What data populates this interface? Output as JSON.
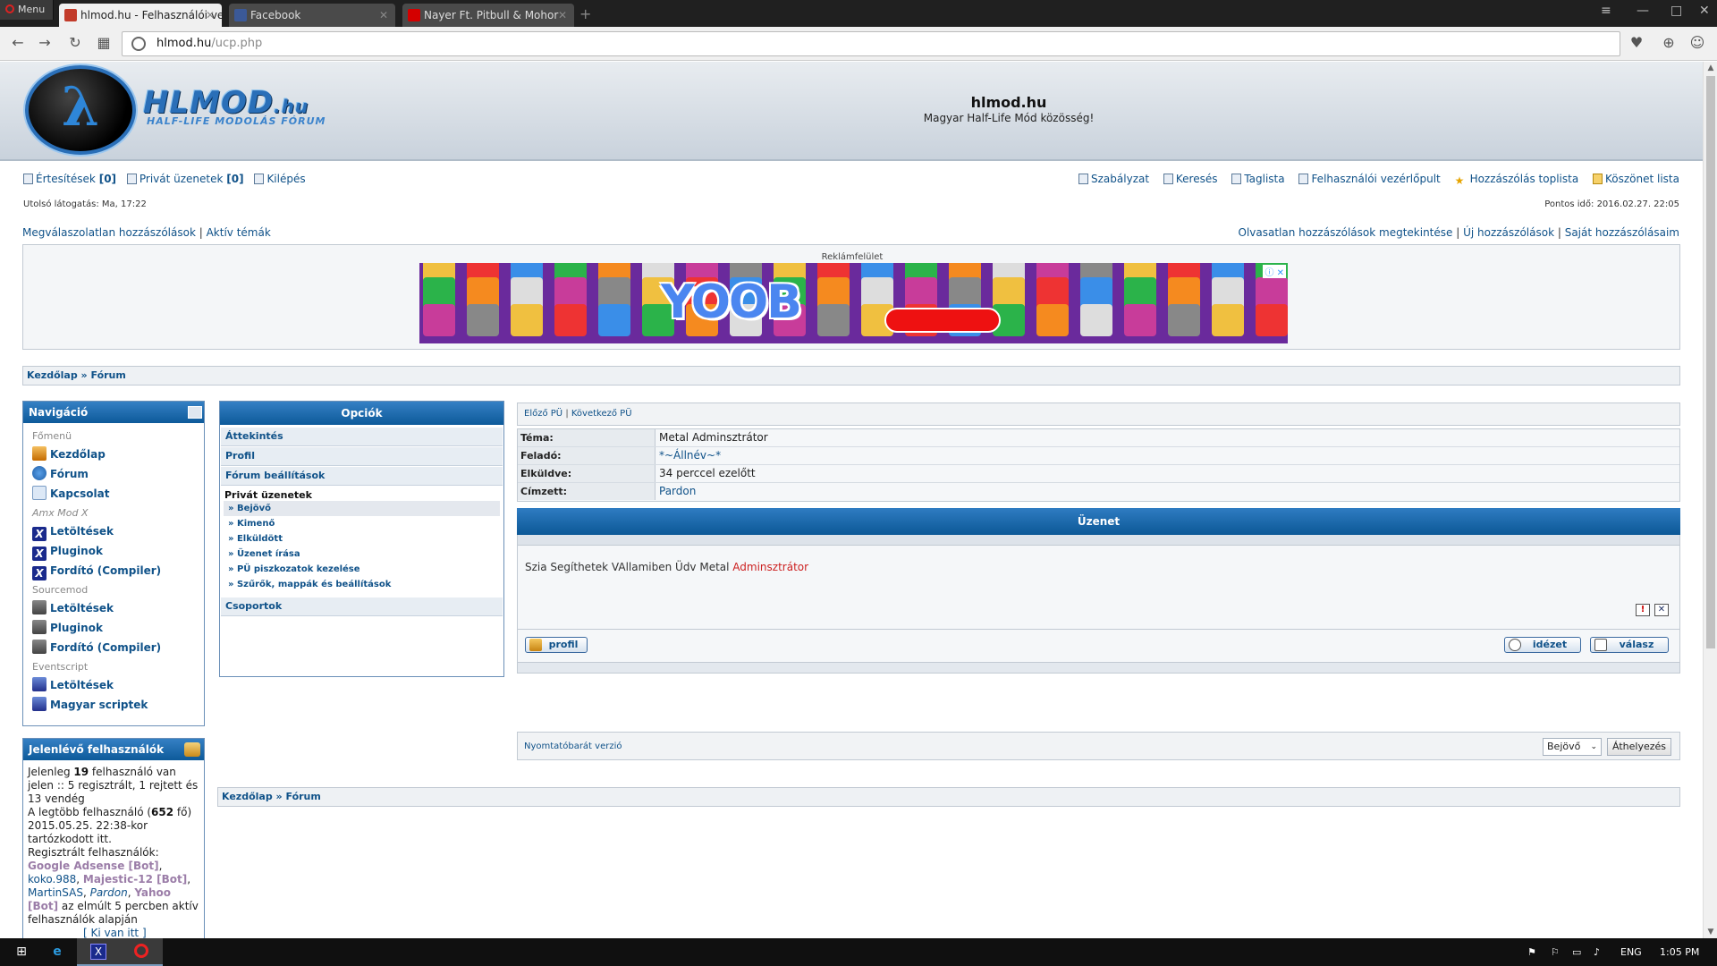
{
  "browser": {
    "menu_label": "Menu",
    "tabs": [
      {
        "title": "hlmod.hu - Felhasználói vez",
        "color": "#c23b2a",
        "active": true
      },
      {
        "title": "Facebook",
        "color": "#3b5998",
        "active": false
      },
      {
        "title": "Nayer Ft. Pitbull & Mohor",
        "color": "#d40000",
        "active": false
      }
    ],
    "url_host": "hlmod.hu",
    "url_path": "/ucp.php"
  },
  "header": {
    "logo_text": "HLMOD",
    "logo_tld": ".hu",
    "logo_sub": "HALF-LIFE MODOLÁS FÓRUM",
    "site_title": "hlmod.hu",
    "slogan": "Magyar Half-Life Mód közösség!"
  },
  "toplinks": {
    "notifications": "Értesítések",
    "notifications_count": "[0]",
    "pm": "Privát üzenetek",
    "pm_count": "[0]",
    "logout": "Kilépés",
    "rules": "Szabályzat",
    "search": "Keresés",
    "members": "Taglista",
    "ucp": "Felhasználói vezérlőpult",
    "top_posters": "Hozzászólás toplista",
    "thanks_list": "Köszönet lista"
  },
  "status": {
    "last_visit": "Utolsó látogatás: Ma, 17:22",
    "current_time": "Pontos idő: 2016.02.27. 22:05"
  },
  "quicklinks": {
    "unanswered": "Megválaszolatlan hozzászólások",
    "active": "Aktív témák",
    "unread": "Olvasatlan hozzászólások megtekintése",
    "new_posts": "Új hozzászólások",
    "own_posts": "Saját hozzászólásaim"
  },
  "ad": {
    "label": "Reklámfelület",
    "brand": "YOOB"
  },
  "breadcrumb": {
    "home": "Kezdőlap",
    "sep": "»",
    "forum": "Fórum"
  },
  "navigation": {
    "title": "Navigáció",
    "cat_main": "Főmenü",
    "home": "Kezdőlap",
    "forum": "Fórum",
    "contact": "Kapcsolat",
    "cat_amx": "Amx Mod X",
    "amx_downloads": "Letöltések",
    "amx_plugins": "Pluginok",
    "amx_compiler": "Fordító (Compiler)",
    "cat_source": "Sourcemod",
    "src_downloads": "Letöltések",
    "src_plugins": "Pluginok",
    "src_compiler": "Fordító (Compiler)",
    "cat_event": "Eventscript",
    "evt_downloads": "Letöltések",
    "evt_scripts": "Magyar scriptek"
  },
  "online": {
    "title": "Jelenlévő felhasználók",
    "l1a": "Jelenleg ",
    "count": "19",
    "l1b": " felhasználó van jelen :: 5 regisztrált, 1 rejtett és 13 vendég",
    "l2a": "A legtöbb felhasználó (",
    "max": "652",
    "l2b": " fő) 2015.05.25. 22:38-kor tartózkodott itt.",
    "l3": "Regisztrált felhasználók:",
    "u1": "Google Adsense [Bot]",
    "u2": "koko.988",
    "u3": "Majestic-12 [Bot]",
    "u4": "MartinSAS",
    "u5": "Pardon",
    "u6": "Yahoo [Bot]",
    "l4": " az elmúlt 5 percben aktív felhasználók alapján",
    "who": "[ Ki van itt ]"
  },
  "options": {
    "title": "Opciók",
    "overview": "Áttekintés",
    "profile": "Profil",
    "forum_settings": "Fórum beállítások",
    "pm_head": "Privát üzenetek",
    "inbox": "» Bejövő",
    "outbox": "» Kimenő",
    "sent": "» Elküldött",
    "compose": "» Üzenet írása",
    "drafts": "» PÜ piszkozatok kezelése",
    "filters": "» Szűrők, mappák és beállítások",
    "groups": "Csoportok"
  },
  "pm": {
    "prev": "Előző PÜ",
    "sep": "|",
    "next": "Következő PÜ",
    "subject_k": "Téma:",
    "subject_v": "Metal Adminsztrátor",
    "from_k": "Feladó:",
    "from_v": "*~Állnév~*",
    "sent_k": "Elküldve:",
    "sent_v": "34 perccel ezelőtt",
    "to_k": "Címzett:",
    "to_v": "Pardon",
    "message_head": "Üzenet",
    "body_a": "Szia Segíthetek VAllamiben Üdv Metal ",
    "body_b": "Adminsztrátor",
    "report_icon": "!",
    "delete_icon": "✕",
    "profile_btn": "profil",
    "quote_btn": "idézet",
    "reply_btn": "válasz",
    "print": "Nyomtatóbarát verzió",
    "folder_select": "Bejövő",
    "move_btn": "Áthelyezés"
  },
  "taskbar": {
    "lang": "ENG",
    "time": "1:05 PM"
  }
}
